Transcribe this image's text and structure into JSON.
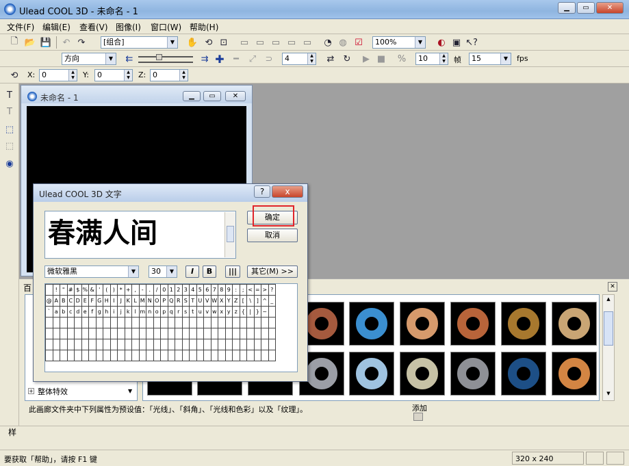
{
  "window": {
    "title": "Ulead COOL 3D - 未命名 - 1"
  },
  "menu": [
    "文件(F)",
    "编辑(E)",
    "查看(V)",
    "图像(I)",
    "窗口(W)",
    "帮助(H)"
  ],
  "toolbar1": {
    "object_combo": "[组合]",
    "zoom_combo": "100%"
  },
  "toolbar2": {
    "direction_combo": "方向",
    "frame_value": "4",
    "fps_frames": "10",
    "frame_label": "帧",
    "fps_value": "15",
    "fps_label": "fps"
  },
  "toolbar3": {
    "x_label": "X:",
    "x_value": "0",
    "y_label": "Y:",
    "y_value": "0",
    "z_label": "Z:",
    "z_value": "0"
  },
  "doc_window": {
    "title": "未命名 - 1"
  },
  "dialog": {
    "title": "Ulead COOL 3D 文字",
    "help_glyph": "?",
    "close_glyph": "x",
    "text": "春满人间",
    "ok_label": "确定",
    "cancel_label": "取消",
    "font_combo": "微软雅黑",
    "size_combo": "30",
    "italic_label": "I",
    "bold_label": "B",
    "other_label": "其它(M) >>",
    "char_rows": [
      [
        " ",
        "!",
        "\"",
        "#",
        "$",
        "%",
        "&",
        "'",
        "(",
        ")",
        "*",
        "+",
        ",",
        "-",
        ".",
        "/",
        "0",
        "1",
        "2",
        "3",
        "4",
        "5",
        "6",
        "7",
        "8",
        "9",
        ":",
        ";",
        "<",
        "=",
        ">",
        "?"
      ],
      [
        "@",
        "A",
        "B",
        "C",
        "D",
        "E",
        "F",
        "G",
        "H",
        "I",
        "J",
        "K",
        "L",
        "M",
        "N",
        "O",
        "P",
        "Q",
        "R",
        "S",
        "T",
        "U",
        "V",
        "W",
        "X",
        "Y",
        "Z",
        "[",
        "\\",
        "]",
        "^",
        "_"
      ],
      [
        "`",
        "a",
        "b",
        "c",
        "d",
        "e",
        "f",
        "g",
        "h",
        "i",
        "j",
        "k",
        "l",
        "m",
        "n",
        "o",
        "p",
        "q",
        "r",
        "s",
        "t",
        "u",
        "v",
        "w",
        "x",
        "y",
        "z",
        "{",
        "|",
        "}",
        "~",
        ""
      ]
    ],
    "highlight_color": "#e0242a"
  },
  "gallery": {
    "tab_label": "百",
    "tree_item": "整体特效",
    "description": "此画廊文件夹中下列属性为预设值：「光线」、「斜角」、「光线和色彩」以及「纹理」。",
    "add_label": "添加",
    "style_label": "样"
  },
  "status": {
    "help_text": "要获取「帮助」，请按 F1 键",
    "dimensions": "320 x 240"
  }
}
